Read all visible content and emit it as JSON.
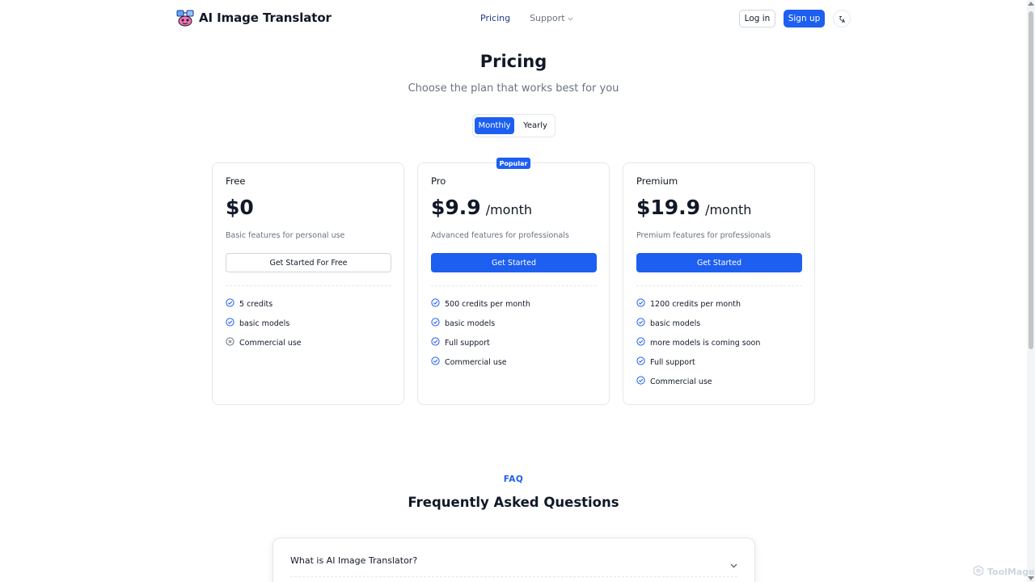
{
  "header": {
    "app_title": "AI Image Translator",
    "logo_icon": "robot-mascot-icon",
    "nav": {
      "pricing": "Pricing",
      "support": "Support"
    },
    "login": "Log in",
    "signup": "Sign up",
    "theme_icon": "theme-toggle-icon"
  },
  "hero": {
    "title": "Pricing",
    "subtitle": "Choose the plan that works best for you",
    "billing": {
      "monthly": "Monthly",
      "yearly": "Yearly",
      "selected": "Monthly"
    }
  },
  "plans": [
    {
      "name": "Free",
      "price": "$0",
      "period": "",
      "description": "Basic features for personal use",
      "cta": "Get Started For Free",
      "cta_style": "outline",
      "features": [
        {
          "text": "5 credits",
          "included": true
        },
        {
          "text": "basic models",
          "included": true
        },
        {
          "text": "Commercial use",
          "included": false
        }
      ]
    },
    {
      "name": "Pro",
      "badge": "Popular",
      "price": "$9.9",
      "period": "/month",
      "description": "Advanced features for professionals",
      "cta": "Get Started",
      "cta_style": "solid",
      "features": [
        {
          "text": "500 credits per month",
          "included": true
        },
        {
          "text": "basic models",
          "included": true
        },
        {
          "text": "Full support",
          "included": true
        },
        {
          "text": "Commercial use",
          "included": true
        }
      ]
    },
    {
      "name": "Premium",
      "price": "$19.9",
      "period": "/month",
      "description": "Premium features for professionals",
      "cta": "Get Started",
      "cta_style": "solid",
      "features": [
        {
          "text": "1200 credits per month",
          "included": true
        },
        {
          "text": "basic models",
          "included": true
        },
        {
          "text": "more models is coming soon",
          "included": true
        },
        {
          "text": "Full support",
          "included": true
        },
        {
          "text": "Commercial use",
          "included": true
        }
      ]
    }
  ],
  "faq": {
    "eyebrow": "FAQ",
    "title": "Frequently Asked Questions",
    "items": [
      {
        "question": "What is AI Image Translator?"
      }
    ]
  },
  "watermark": "ToolMage",
  "colors": {
    "accent": "#1d5ff0",
    "nav_active": "#1e3a8a",
    "text_muted": "#6b7280",
    "border": "#e5e7eb"
  }
}
